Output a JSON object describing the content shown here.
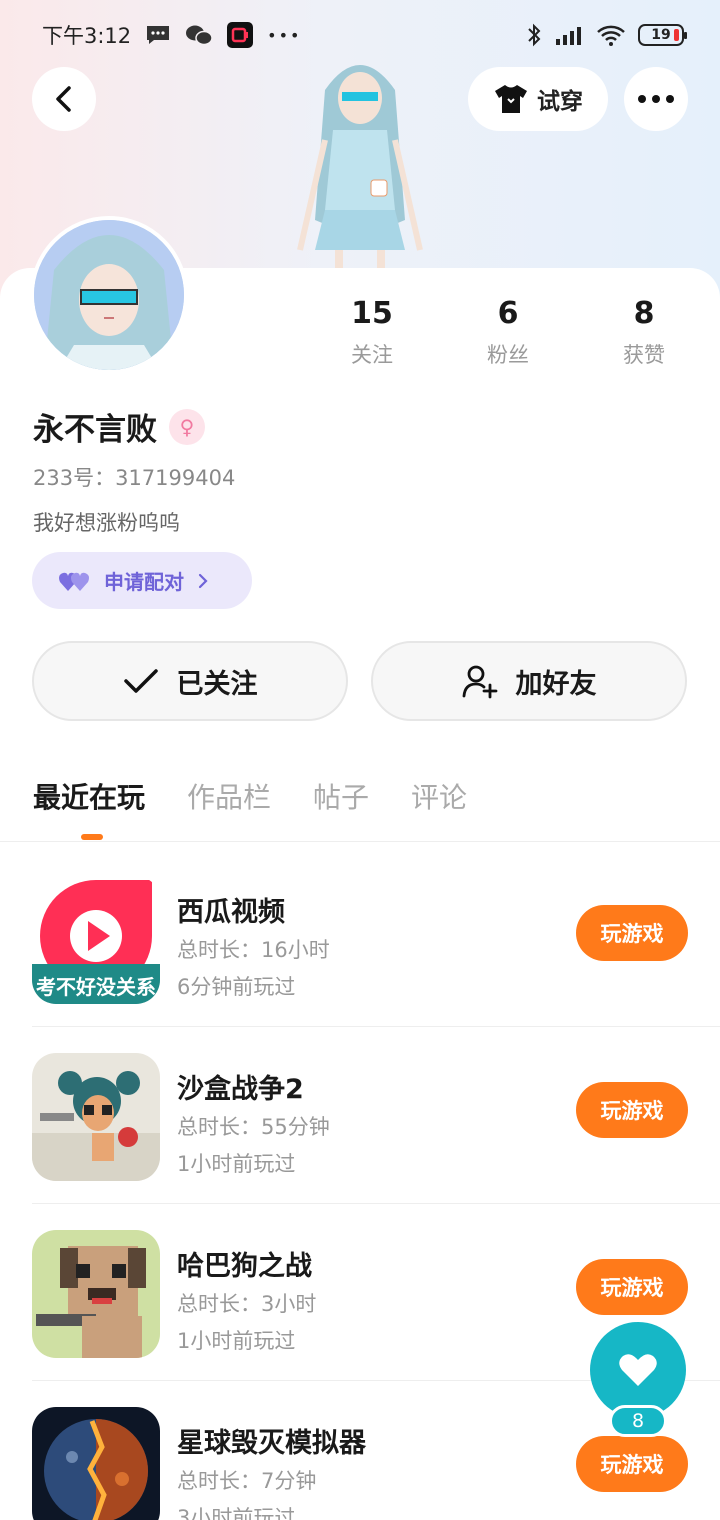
{
  "status_bar": {
    "time": "下午3:12",
    "dots": "•••",
    "battery": "19"
  },
  "header": {
    "try_on_label": "试穿"
  },
  "profile": {
    "username": "永不言败",
    "gender_symbol": "♀",
    "uid": "233号：317199404",
    "bio": "我好想涨粉呜呜",
    "pair_label": "申请配对",
    "stats": [
      {
        "value": "15",
        "label": "关注"
      },
      {
        "value": "6",
        "label": "粉丝"
      },
      {
        "value": "8",
        "label": "获赞"
      }
    ]
  },
  "actions": {
    "followed_label": "已关注",
    "add_friend_label": "加好友"
  },
  "tabs": [
    {
      "label": "最近在玩",
      "active": true
    },
    {
      "label": "作品栏",
      "active": false
    },
    {
      "label": "帖子",
      "active": false
    },
    {
      "label": "评论",
      "active": false
    }
  ],
  "games": [
    {
      "name": "西瓜视频",
      "duration": "总时长：16小时",
      "last_played": "6分钟前玩过",
      "thumb_caption": "考不好没关系",
      "play_label": "玩游戏"
    },
    {
      "name": "沙盒战争2",
      "duration": "总时长：55分钟",
      "last_played": "1小时前玩过",
      "play_label": "玩游戏"
    },
    {
      "name": "哈巴狗之战",
      "duration": "总时长：3小时",
      "last_played": "1小时前玩过",
      "play_label": "玩游戏"
    },
    {
      "name": "星球毁灭模拟器",
      "duration": "总时长：7分钟",
      "last_played": "3小时前玩过",
      "play_label": "玩游戏"
    }
  ],
  "like_fab": {
    "count": "8"
  },
  "colors": {
    "accent_orange": "#ff7a1a",
    "fab_teal": "#16b7c6",
    "pair_purple": "#6f63d8"
  }
}
